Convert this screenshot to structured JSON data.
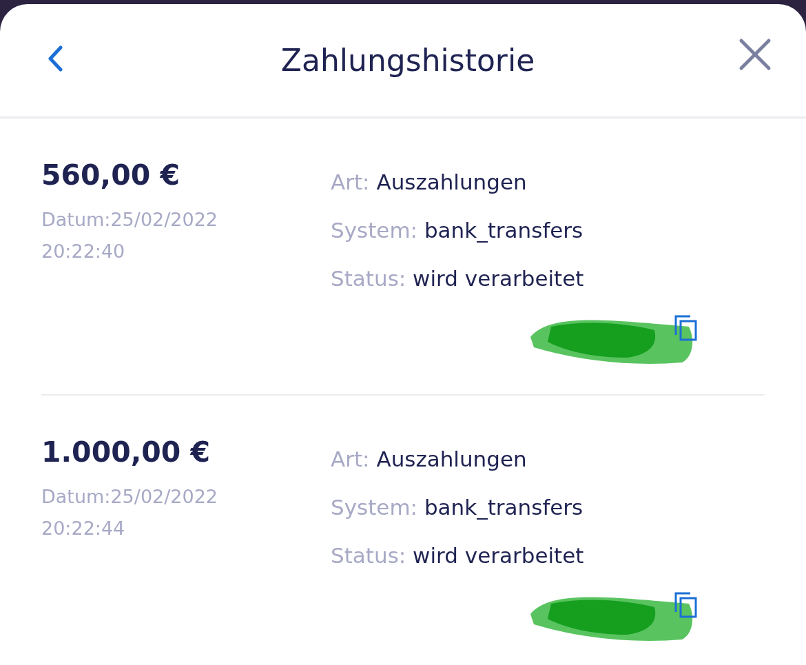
{
  "header": {
    "title": "Zahlungshistorie"
  },
  "payments": [
    {
      "amount": "560,00 €",
      "date": "Datum:25/02/2022",
      "time": "20:22:40",
      "details": [
        {
          "label": "Art:",
          "value": "Auszahlungen"
        },
        {
          "label": "System:",
          "value": "bank_transfers"
        },
        {
          "label": "Status:",
          "value": "wird verarbeitet"
        }
      ]
    },
    {
      "amount": "1.000,00 €",
      "date": "Datum:25/02/2022",
      "time": "20:22:44",
      "details": [
        {
          "label": "Art:",
          "value": "Auszahlungen"
        },
        {
          "label": "System:",
          "value": "bank_transfers"
        },
        {
          "label": "Status:",
          "value": "wird verarbeitet"
        }
      ]
    }
  ]
}
